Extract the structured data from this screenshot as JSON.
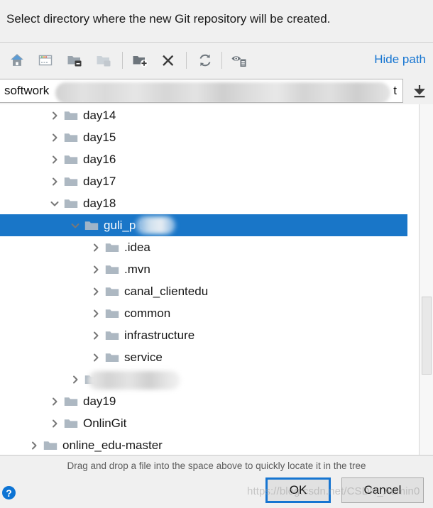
{
  "header": {
    "title": "Select directory where the new Git repository will be created."
  },
  "toolbar": {
    "buttons": [
      {
        "name": "home-icon",
        "tooltip": "Home"
      },
      {
        "name": "desktop-icon",
        "tooltip": "Desktop"
      },
      {
        "name": "collapse-folder-icon",
        "tooltip": "Collapse"
      },
      {
        "name": "expand-folder-icon",
        "tooltip": "Expand"
      },
      {
        "name": "new-folder-icon",
        "tooltip": "New Folder"
      },
      {
        "name": "delete-icon",
        "tooltip": "Delete"
      },
      {
        "name": "refresh-icon",
        "tooltip": "Refresh"
      },
      {
        "name": "show-hidden-icon",
        "tooltip": "Show Hidden Files"
      }
    ],
    "hide_path_label": "Hide path"
  },
  "path": {
    "visible_prefix": "softwork",
    "visible_suffix": "t",
    "redacted": true,
    "placeholder": ""
  },
  "tree": {
    "rows": [
      {
        "label": "day14",
        "indent": 1,
        "expanded": false,
        "selected": false,
        "hasTwisty": true,
        "redacted": false
      },
      {
        "label": "day15",
        "indent": 1,
        "expanded": false,
        "selected": false,
        "hasTwisty": true,
        "redacted": false
      },
      {
        "label": "day16",
        "indent": 1,
        "expanded": false,
        "selected": false,
        "hasTwisty": true,
        "redacted": false
      },
      {
        "label": "day17",
        "indent": 1,
        "expanded": false,
        "selected": false,
        "hasTwisty": true,
        "redacted": false
      },
      {
        "label": "day18",
        "indent": 1,
        "expanded": true,
        "selected": false,
        "hasTwisty": true,
        "redacted": false
      },
      {
        "label": "guli_p          t",
        "indent": 2,
        "expanded": true,
        "selected": true,
        "hasTwisty": true,
        "redacted": true
      },
      {
        "label": ".idea",
        "indent": 3,
        "expanded": false,
        "selected": false,
        "hasTwisty": true,
        "redacted": false
      },
      {
        "label": ".mvn",
        "indent": 3,
        "expanded": false,
        "selected": false,
        "hasTwisty": true,
        "redacted": false
      },
      {
        "label": "canal_clientedu",
        "indent": 3,
        "expanded": false,
        "selected": false,
        "hasTwisty": true,
        "redacted": false
      },
      {
        "label": "common",
        "indent": 3,
        "expanded": false,
        "selected": false,
        "hasTwisty": true,
        "redacted": false
      },
      {
        "label": "infrastructure",
        "indent": 3,
        "expanded": false,
        "selected": false,
        "hasTwisty": true,
        "redacted": false
      },
      {
        "label": "service",
        "indent": 3,
        "expanded": false,
        "selected": false,
        "hasTwisty": true,
        "redacted": false
      },
      {
        "label": "",
        "indent": 2,
        "expanded": false,
        "selected": false,
        "hasTwisty": true,
        "redacted": true
      },
      {
        "label": "day19",
        "indent": 1,
        "expanded": false,
        "selected": false,
        "hasTwisty": true,
        "redacted": false
      },
      {
        "label": "OnlinGit",
        "indent": 1,
        "expanded": false,
        "selected": false,
        "hasTwisty": true,
        "redacted": false
      },
      {
        "label": "online_edu-master",
        "indent": 0,
        "expanded": false,
        "selected": false,
        "hasTwisty": true,
        "redacted": false
      }
    ]
  },
  "hint": {
    "text": "Drag and drop a file into the space above to quickly locate it in the tree"
  },
  "footer": {
    "help_label": "?",
    "ok_label": "OK",
    "cancel_label": "Cancel",
    "watermark": "https://blog.csdn.net/CSDN_Admin0"
  },
  "colors": {
    "accent": "#1976c8",
    "link": "#1675d1",
    "dialog_bg": "#f0f0f0",
    "tree_bg": "#ffffff",
    "folder": "#adb8c2"
  }
}
